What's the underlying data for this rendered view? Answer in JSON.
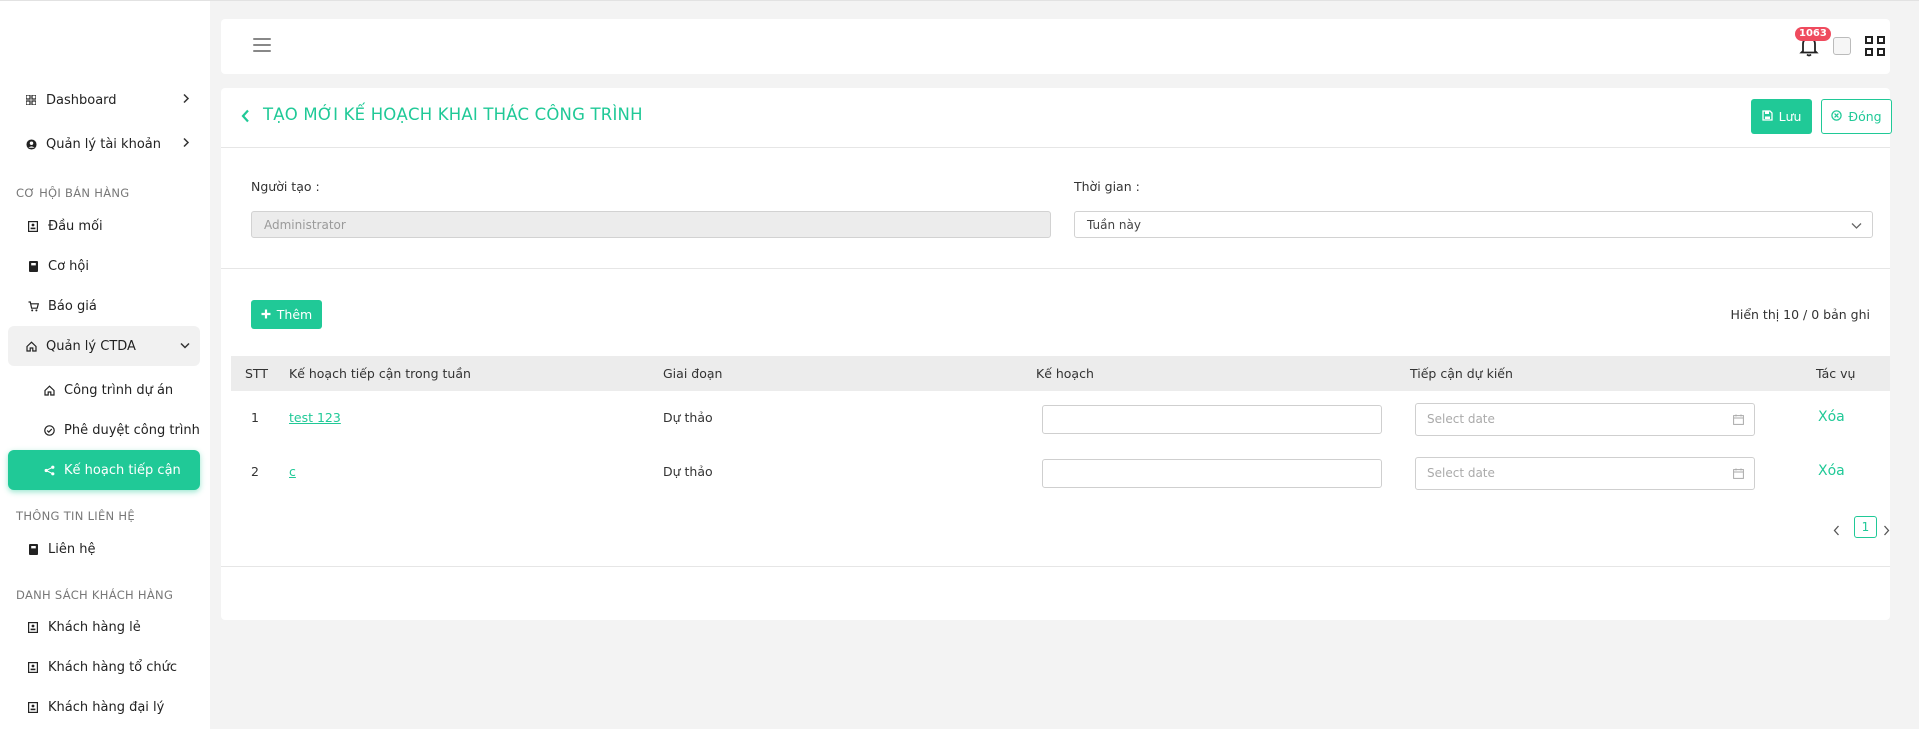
{
  "sidebar": {
    "items": [
      {
        "label": "Dashboard",
        "icon": "grid-icon"
      },
      {
        "label": "Quản lý tài khoản",
        "icon": "user-circle-icon"
      }
    ],
    "sections": [
      {
        "title": "CƠ HỘI BÁN HÀNG"
      },
      {
        "title": "THÔNG TIN LIÊN HỆ"
      },
      {
        "title": "DANH SÁCH KHÁCH HÀNG"
      }
    ],
    "sales": [
      {
        "label": "Đầu mối",
        "icon": "contact-card-icon"
      },
      {
        "label": "Cơ hội",
        "icon": "bookmark-icon"
      },
      {
        "label": "Báo giá",
        "icon": "cart-icon"
      },
      {
        "label": "Quản lý CTDA",
        "icon": "home-icon"
      }
    ],
    "ctda_sub": [
      {
        "label": "Công trình dự án",
        "icon": "home-icon"
      },
      {
        "label": "Phê duyệt công trình",
        "icon": "check-circle-icon"
      },
      {
        "label": "Kế hoạch tiếp cận",
        "icon": "share-icon"
      }
    ],
    "contacts": [
      {
        "label": "Liên hệ",
        "icon": "bookmark-icon"
      }
    ],
    "customers": [
      {
        "label": "Khách hàng lẻ",
        "icon": "contact-card-icon"
      },
      {
        "label": "Khách hàng tổ chức",
        "icon": "contact-card-icon"
      },
      {
        "label": "Khách hàng đại lý",
        "icon": "contact-card-icon"
      }
    ]
  },
  "header": {
    "notification_count": "1063"
  },
  "page": {
    "title": "TẠO MỚI KẾ HOẠCH KHAI THÁC CÔNG TRÌNH",
    "save_label": "Lưu",
    "close_label": "Đóng",
    "creator_label": "Người tạo :",
    "creator_placeholder": "Administrator",
    "time_label": "Thời gian :",
    "time_value": "Tuần này",
    "add_label": "Thêm",
    "record_count": "Hiển thị 10 / 0 bản ghi"
  },
  "table": {
    "headers": [
      "STT",
      "Kế hoạch tiếp cận trong tuần",
      "Giai đoạn",
      "Kế hoạch",
      "Tiếp cận dự kiến",
      "Tác vụ"
    ],
    "date_placeholder": "Select date",
    "rows": [
      {
        "stt": "1",
        "plan": "test 123",
        "stage": "Dự thảo",
        "action": "Xóa"
      },
      {
        "stt": "2",
        "plan": "c",
        "stage": "Dự thảo",
        "action": "Xóa"
      }
    ]
  },
  "pagination": {
    "current_page": "1"
  },
  "colors": {
    "accent": "#20c997",
    "badge": "#ef4b5e"
  }
}
